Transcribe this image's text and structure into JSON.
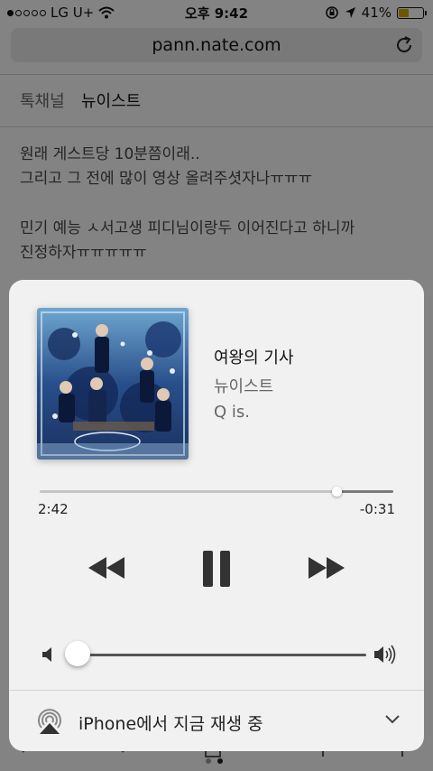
{
  "status_bar": {
    "carrier": "LG U+",
    "time": "오후 9:42",
    "battery_percent": "41%",
    "battery_level": 0.41,
    "battery_color": "#d4a000"
  },
  "browser": {
    "url": "pann.nate.com",
    "reload_icon": "reload-icon"
  },
  "article": {
    "channel_label": "톡채널",
    "channel_name": "뉴이스트",
    "paragraphs": [
      [
        "원래 게스트당 10분쯤이래..",
        "그리고 그 전에 많이 영상 올려주셧자나ㅠㅠㅠ"
      ],
      [
        "민기 예능 ㅅ서고생 피디님이랑두 이어진다고 하니까",
        "진정하자ㅠㅠㅠㅠㅠ"
      ]
    ]
  },
  "now_playing": {
    "title": "여왕의 기사",
    "artist": "뉴이스트",
    "album": "Q is.",
    "elapsed": "2:42",
    "remaining": "-0:31",
    "progress": 0.84,
    "volume": 0.0,
    "controls": {
      "rewind": "rewind-icon",
      "play_pause": "pause-icon",
      "forward": "fast-forward-icon"
    },
    "airplay_label": "iPhone에서 지금 재생 중"
  },
  "pager": {
    "pages": 2,
    "current": 2
  }
}
